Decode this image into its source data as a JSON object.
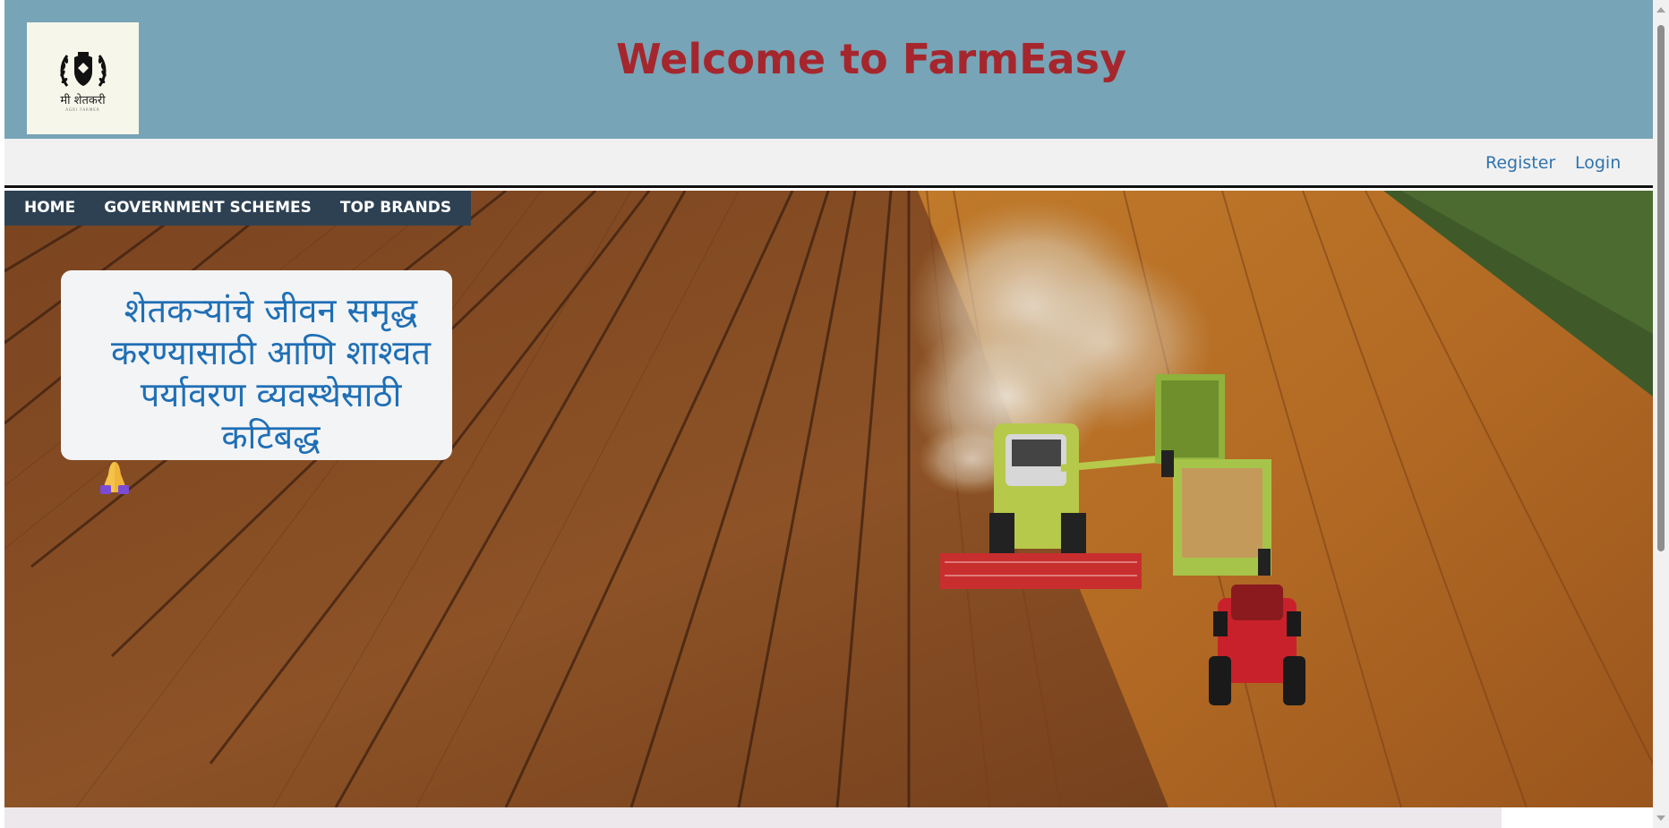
{
  "header": {
    "title": "Welcome to FarmEasy",
    "logo_text": "मी शेतकरी",
    "logo_subtext": "AGRI FARMER"
  },
  "auth": {
    "register_label": "Register",
    "login_label": "Login"
  },
  "nav": {
    "items": [
      {
        "label": "HOME"
      },
      {
        "label": "GOVERNMENT SCHEMES"
      },
      {
        "label": "TOP BRANDS"
      }
    ]
  },
  "hero": {
    "tagline": "शेतकऱ्यांचे जीवन समृद्ध करण्यासाठी आणि शाश्वत पर्यावरण व्यवस्थेसाठी कटिबद्ध",
    "tagline_icon": "folded-hands-icon"
  },
  "colors": {
    "header_bg": "#77a4b6",
    "title": "#a6262d",
    "nav_bg": "#2e4153",
    "link": "#2f74ad",
    "tagline": "#1f6fb5"
  }
}
